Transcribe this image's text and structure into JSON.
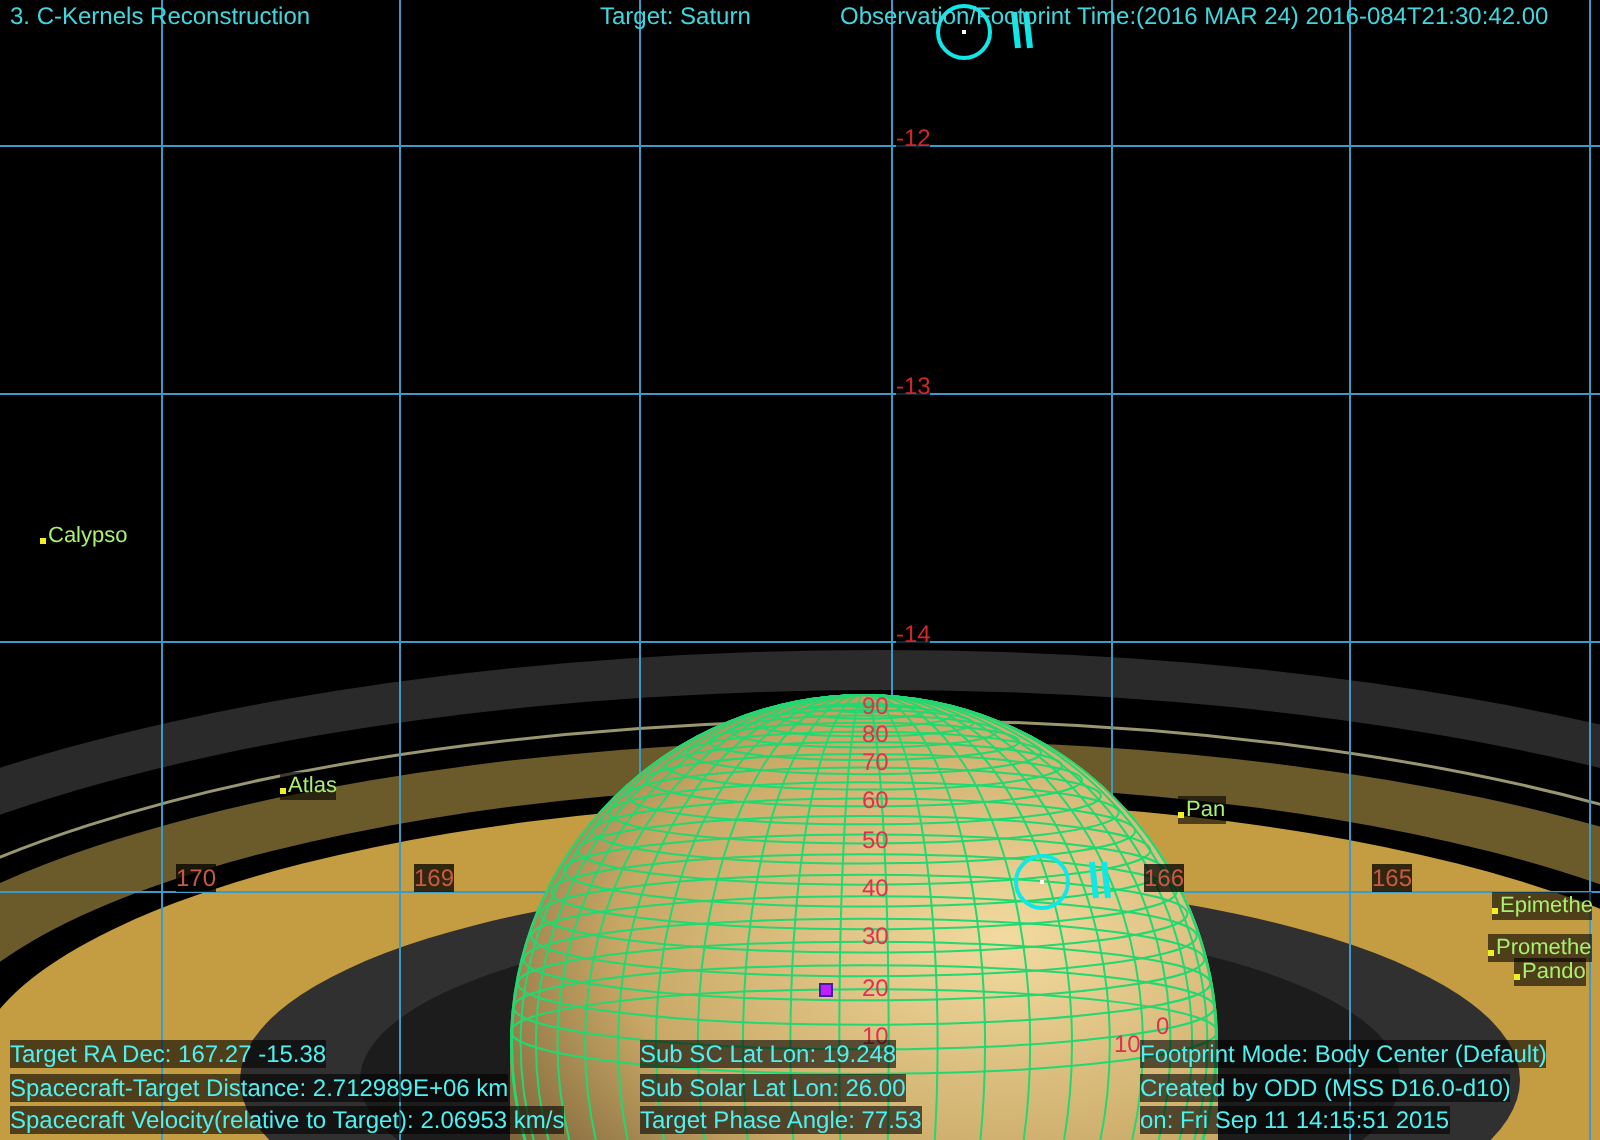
{
  "header": {
    "title": "3. C-Kernels Reconstruction",
    "target": "Target: Saturn",
    "time": "Observation/Footprint Time:(2016 MAR 24) 2016-084T21:30:42.00"
  },
  "grid_labels": {
    "dec": [
      "-12",
      "-13",
      "-14"
    ],
    "ra": [
      "170",
      "169",
      "166",
      "165"
    ]
  },
  "moons": [
    {
      "name": "Calypso"
    },
    {
      "name": "Atlas"
    },
    {
      "name": "Pan"
    },
    {
      "name": "Epimethe"
    },
    {
      "name": "Promethe"
    },
    {
      "name": "Pando"
    }
  ],
  "latitude_labels": [
    "90",
    "80",
    "70",
    "60",
    "50",
    "40",
    "30",
    "20",
    "10"
  ],
  "longitude_labels": [
    "10",
    "0"
  ],
  "info_left": [
    "Target RA Dec: 167.27  -15.38",
    "Spacecraft-Target Distance: 2.712989E+06 km",
    "Spacecraft Velocity(relative to Target): 2.06953 km/s"
  ],
  "info_middle": [
    "Sub SC Lat Lon: 19.248",
    "Sub Solar Lat Lon: 26.00",
    "Target Phase Angle: 77.53"
  ],
  "info_right": [
    "Footprint Mode: Body Center (Default)",
    "Created by ODD (MSS D16.0-d10)",
    "on: Fri Sep 11 14:15:51 2015"
  ]
}
